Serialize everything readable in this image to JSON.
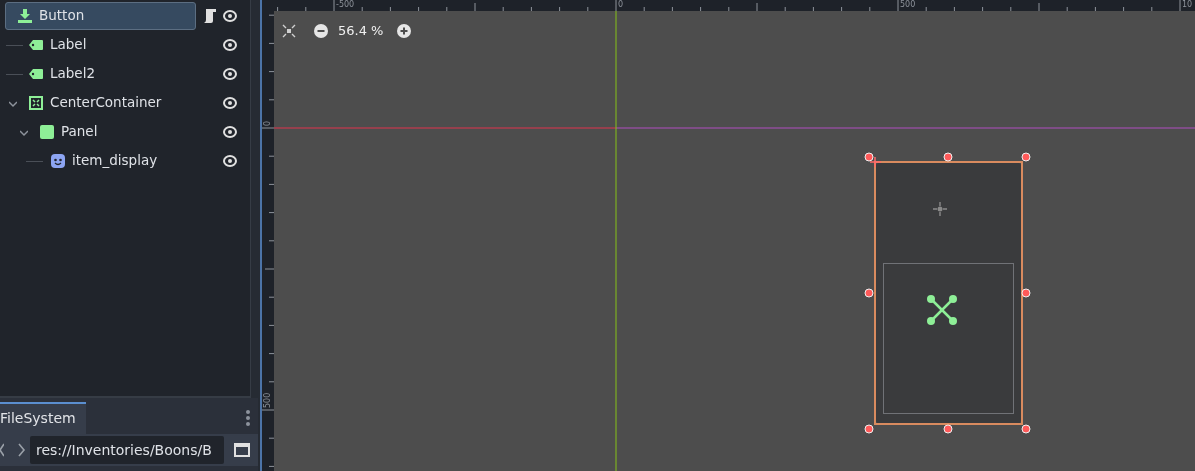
{
  "scene_tree": {
    "items": [
      {
        "label": "Button",
        "kind": "button",
        "selected": true,
        "script": true,
        "visible": true,
        "children": [
          {
            "label": "Label",
            "kind": "label",
            "selected": false,
            "visible": true
          },
          {
            "label": "Label2",
            "kind": "label",
            "selected": false,
            "visible": true
          },
          {
            "label": "CenterContainer",
            "kind": "container",
            "selected": false,
            "visible": true,
            "expanded": true,
            "children": [
              {
                "label": "Panel",
                "kind": "panel",
                "selected": false,
                "visible": true,
                "expanded": true,
                "children": [
                  {
                    "label": "item_display",
                    "kind": "scene",
                    "selected": false,
                    "visible": true
                  }
                ]
              }
            ]
          }
        ]
      }
    ]
  },
  "filesystem": {
    "tab": "FileSystem",
    "path": "res://Inventories/Boons/B"
  },
  "viewport": {
    "zoom": "56.4 %",
    "ruler_top_labels": [
      "-500",
      "0",
      "500",
      "10"
    ],
    "ruler_left_labels": [
      "0",
      "500"
    ]
  }
}
